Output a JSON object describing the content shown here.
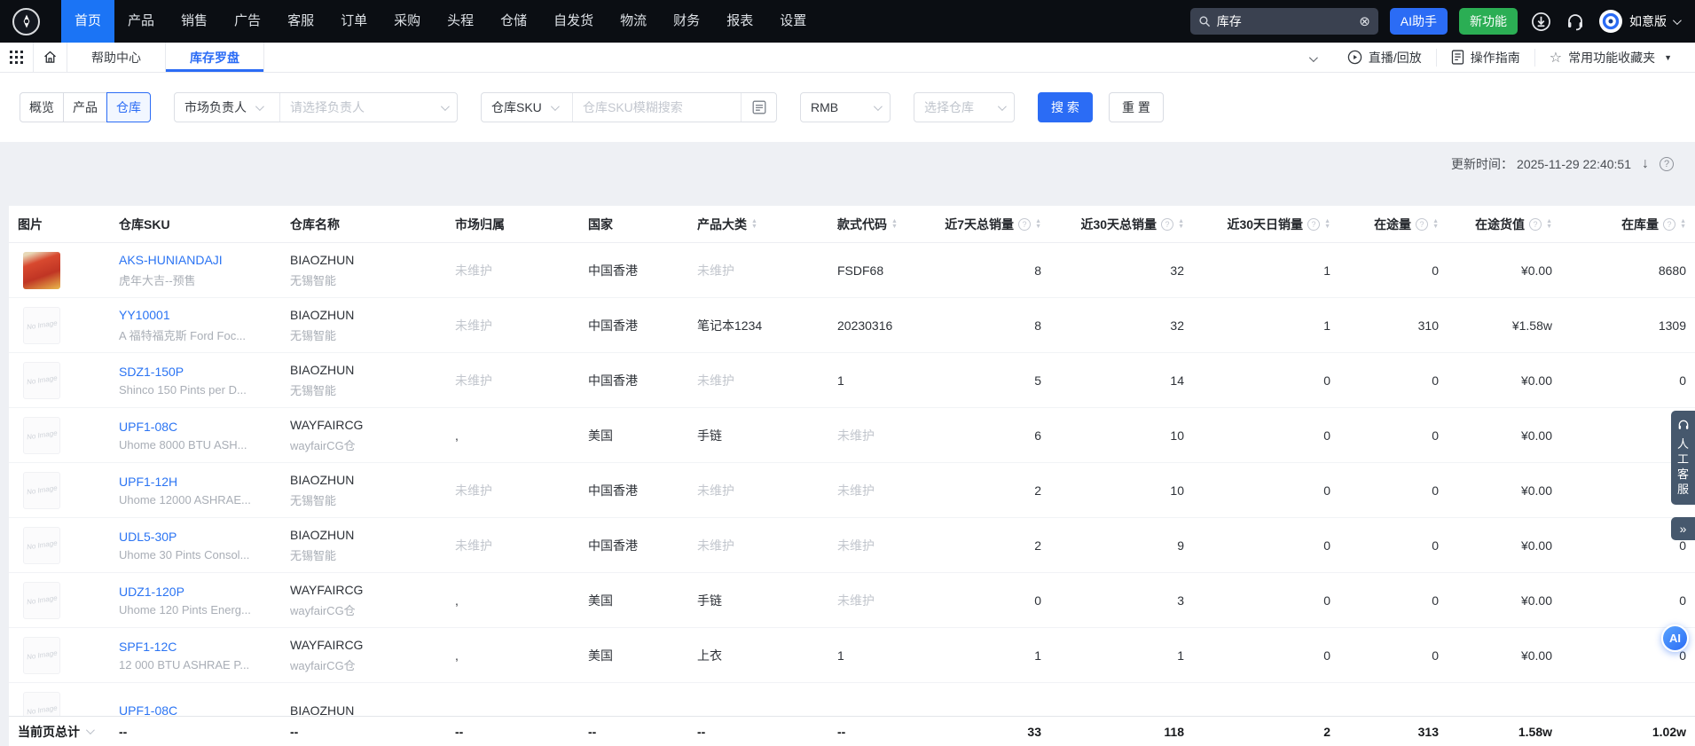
{
  "topnav": {
    "items": [
      "首页",
      "产品",
      "销售",
      "广告",
      "客服",
      "订单",
      "采购",
      "头程",
      "仓储",
      "自发货",
      "物流",
      "财务",
      "报表",
      "设置"
    ],
    "active_index": 0,
    "search_value": "库存",
    "ai_assistant": "AI助手",
    "new_feature": "新功能",
    "edition": "如意版"
  },
  "tabbar": {
    "tabs": [
      {
        "label": "帮助中心",
        "active": false
      },
      {
        "label": "库存罗盘",
        "active": true
      }
    ],
    "live_replay": "直播/回放",
    "guide": "操作指南",
    "favorites": "常用功能收藏夹"
  },
  "filterbar": {
    "views": [
      {
        "label": "概览",
        "active": false
      },
      {
        "label": "产品",
        "active": false
      },
      {
        "label": "仓库",
        "active": true
      }
    ],
    "market_owner": {
      "label": "市场负责人",
      "placeholder": "请选择负责人"
    },
    "sku": {
      "label": "仓库SKU",
      "placeholder": "仓库SKU模糊搜索"
    },
    "currency": "RMB",
    "warehouse_placeholder": "选择仓库",
    "search": "搜 索",
    "reset": "重 置"
  },
  "statusbar": {
    "label": "更新时间：",
    "time": "2025-11-29 22:40:51"
  },
  "table": {
    "no_image_label": "No Image",
    "columns": [
      {
        "label": "图片"
      },
      {
        "label": "仓库SKU"
      },
      {
        "label": "仓库名称"
      },
      {
        "label": "市场归属"
      },
      {
        "label": "国家"
      },
      {
        "label": "产品大类",
        "sort": true
      },
      {
        "label": "款式代码",
        "sort": true
      },
      {
        "label": "近7天总销量",
        "help": true,
        "sort": true,
        "num": true
      },
      {
        "label": "近30天总销量",
        "help": true,
        "sort": true,
        "num": true
      },
      {
        "label": "近30天日销量",
        "help": true,
        "sort": true,
        "num": true
      },
      {
        "label": "在途量",
        "help": true,
        "sort": true,
        "num": true
      },
      {
        "label": "在途货值",
        "help": true,
        "sort": true,
        "num": true
      },
      {
        "label": "在库量",
        "help": true,
        "sort": true,
        "num": true
      }
    ],
    "rows": [
      {
        "image": "product",
        "sku": "AKS-HUNIANDAJI",
        "desc": "虎年大吉--预售",
        "wh": "BIAOZHUN",
        "wh_sub": "无锡智能",
        "market": "未维护",
        "market_muted": true,
        "country": "中国香港",
        "category": "未维护",
        "category_muted": true,
        "style": "FSDF68",
        "style_muted": false,
        "d7": "8",
        "d30": "32",
        "daily": "1",
        "transit": "0",
        "transit_value": "¥0.00",
        "stock": "8680"
      },
      {
        "image": "noimg",
        "sku": "YY10001",
        "desc": "A 福特福克斯 Ford Foc...",
        "wh": "BIAOZHUN",
        "wh_sub": "无锡智能",
        "market": "未维护",
        "market_muted": true,
        "country": "中国香港",
        "category": "笔记本1234",
        "category_muted": false,
        "style": "20230316",
        "style_muted": false,
        "d7": "8",
        "d30": "32",
        "daily": "1",
        "transit": "310",
        "transit_value": "¥1.58w",
        "stock": "1309"
      },
      {
        "image": "noimg",
        "sku": "SDZ1-150P",
        "desc": "Shinco 150 Pints per D...",
        "wh": "BIAOZHUN",
        "wh_sub": "无锡智能",
        "market": "未维护",
        "market_muted": true,
        "country": "中国香港",
        "category": "未维护",
        "category_muted": true,
        "style": "1",
        "style_muted": false,
        "d7": "5",
        "d30": "14",
        "daily": "0",
        "transit": "0",
        "transit_value": "¥0.00",
        "stock": "0"
      },
      {
        "image": "noimg",
        "sku": "UPF1-08C",
        "desc": "Uhome 8000 BTU ASH...",
        "wh": "WAYFAIRCG",
        "wh_sub": "wayfairCG仓",
        "market": ",",
        "market_muted": false,
        "country": "美国",
        "category": "手链",
        "category_muted": false,
        "style": "未维护",
        "style_muted": true,
        "d7": "6",
        "d30": "10",
        "daily": "0",
        "transit": "0",
        "transit_value": "¥0.00",
        "stock": "0"
      },
      {
        "image": "noimg",
        "sku": "UPF1-12H",
        "desc": "Uhome 12000 ASHRAE...",
        "wh": "BIAOZHUN",
        "wh_sub": "无锡智能",
        "market": "未维护",
        "market_muted": true,
        "country": "中国香港",
        "category": "未维护",
        "category_muted": true,
        "style": "未维护",
        "style_muted": true,
        "d7": "2",
        "d30": "10",
        "daily": "0",
        "transit": "0",
        "transit_value": "¥0.00",
        "stock": "0"
      },
      {
        "image": "noimg",
        "sku": "UDL5-30P",
        "desc": "Uhome 30 Pints Consol...",
        "wh": "BIAOZHUN",
        "wh_sub": "无锡智能",
        "market": "未维护",
        "market_muted": true,
        "country": "中国香港",
        "category": "未维护",
        "category_muted": true,
        "style": "未维护",
        "style_muted": true,
        "d7": "2",
        "d30": "9",
        "daily": "0",
        "transit": "0",
        "transit_value": "¥0.00",
        "stock": "0"
      },
      {
        "image": "noimg",
        "sku": "UDZ1-120P",
        "desc": "Uhome 120 Pints Energ...",
        "wh": "WAYFAIRCG",
        "wh_sub": "wayfairCG仓",
        "market": ",",
        "market_muted": false,
        "country": "美国",
        "category": "手链",
        "category_muted": false,
        "style": "未维护",
        "style_muted": true,
        "d7": "0",
        "d30": "3",
        "daily": "0",
        "transit": "0",
        "transit_value": "¥0.00",
        "stock": "0"
      },
      {
        "image": "noimg",
        "sku": "SPF1-12C",
        "desc": "12 000 BTU ASHRAE  P...",
        "wh": "WAYFAIRCG",
        "wh_sub": "wayfairCG仓",
        "market": ",",
        "market_muted": false,
        "country": "美国",
        "category": "上衣",
        "category_muted": false,
        "style": "1",
        "style_muted": false,
        "d7": "1",
        "d30": "1",
        "daily": "0",
        "transit": "0",
        "transit_value": "¥0.00",
        "stock": "0"
      },
      {
        "image": "noimg",
        "sku": "UPF1-08C",
        "desc": "",
        "wh": "BIAOZHUN",
        "wh_sub": "",
        "market": "",
        "market_muted": true,
        "country": "",
        "category": "",
        "category_muted": true,
        "style": "",
        "style_muted": true,
        "d7": "",
        "d30": "",
        "daily": "",
        "transit": "",
        "transit_value": "",
        "stock": ""
      }
    ],
    "footer": {
      "label": "当前页总计",
      "dashes": [
        "--",
        "--",
        "--",
        "--",
        "--",
        "--"
      ],
      "d7": "33",
      "d30": "118",
      "daily": "2",
      "transit": "313",
      "transit_value": "1.58w",
      "stock": "1.02w"
    }
  },
  "floating": {
    "service": "人工客服",
    "collapse": "»",
    "ai": "AI"
  }
}
